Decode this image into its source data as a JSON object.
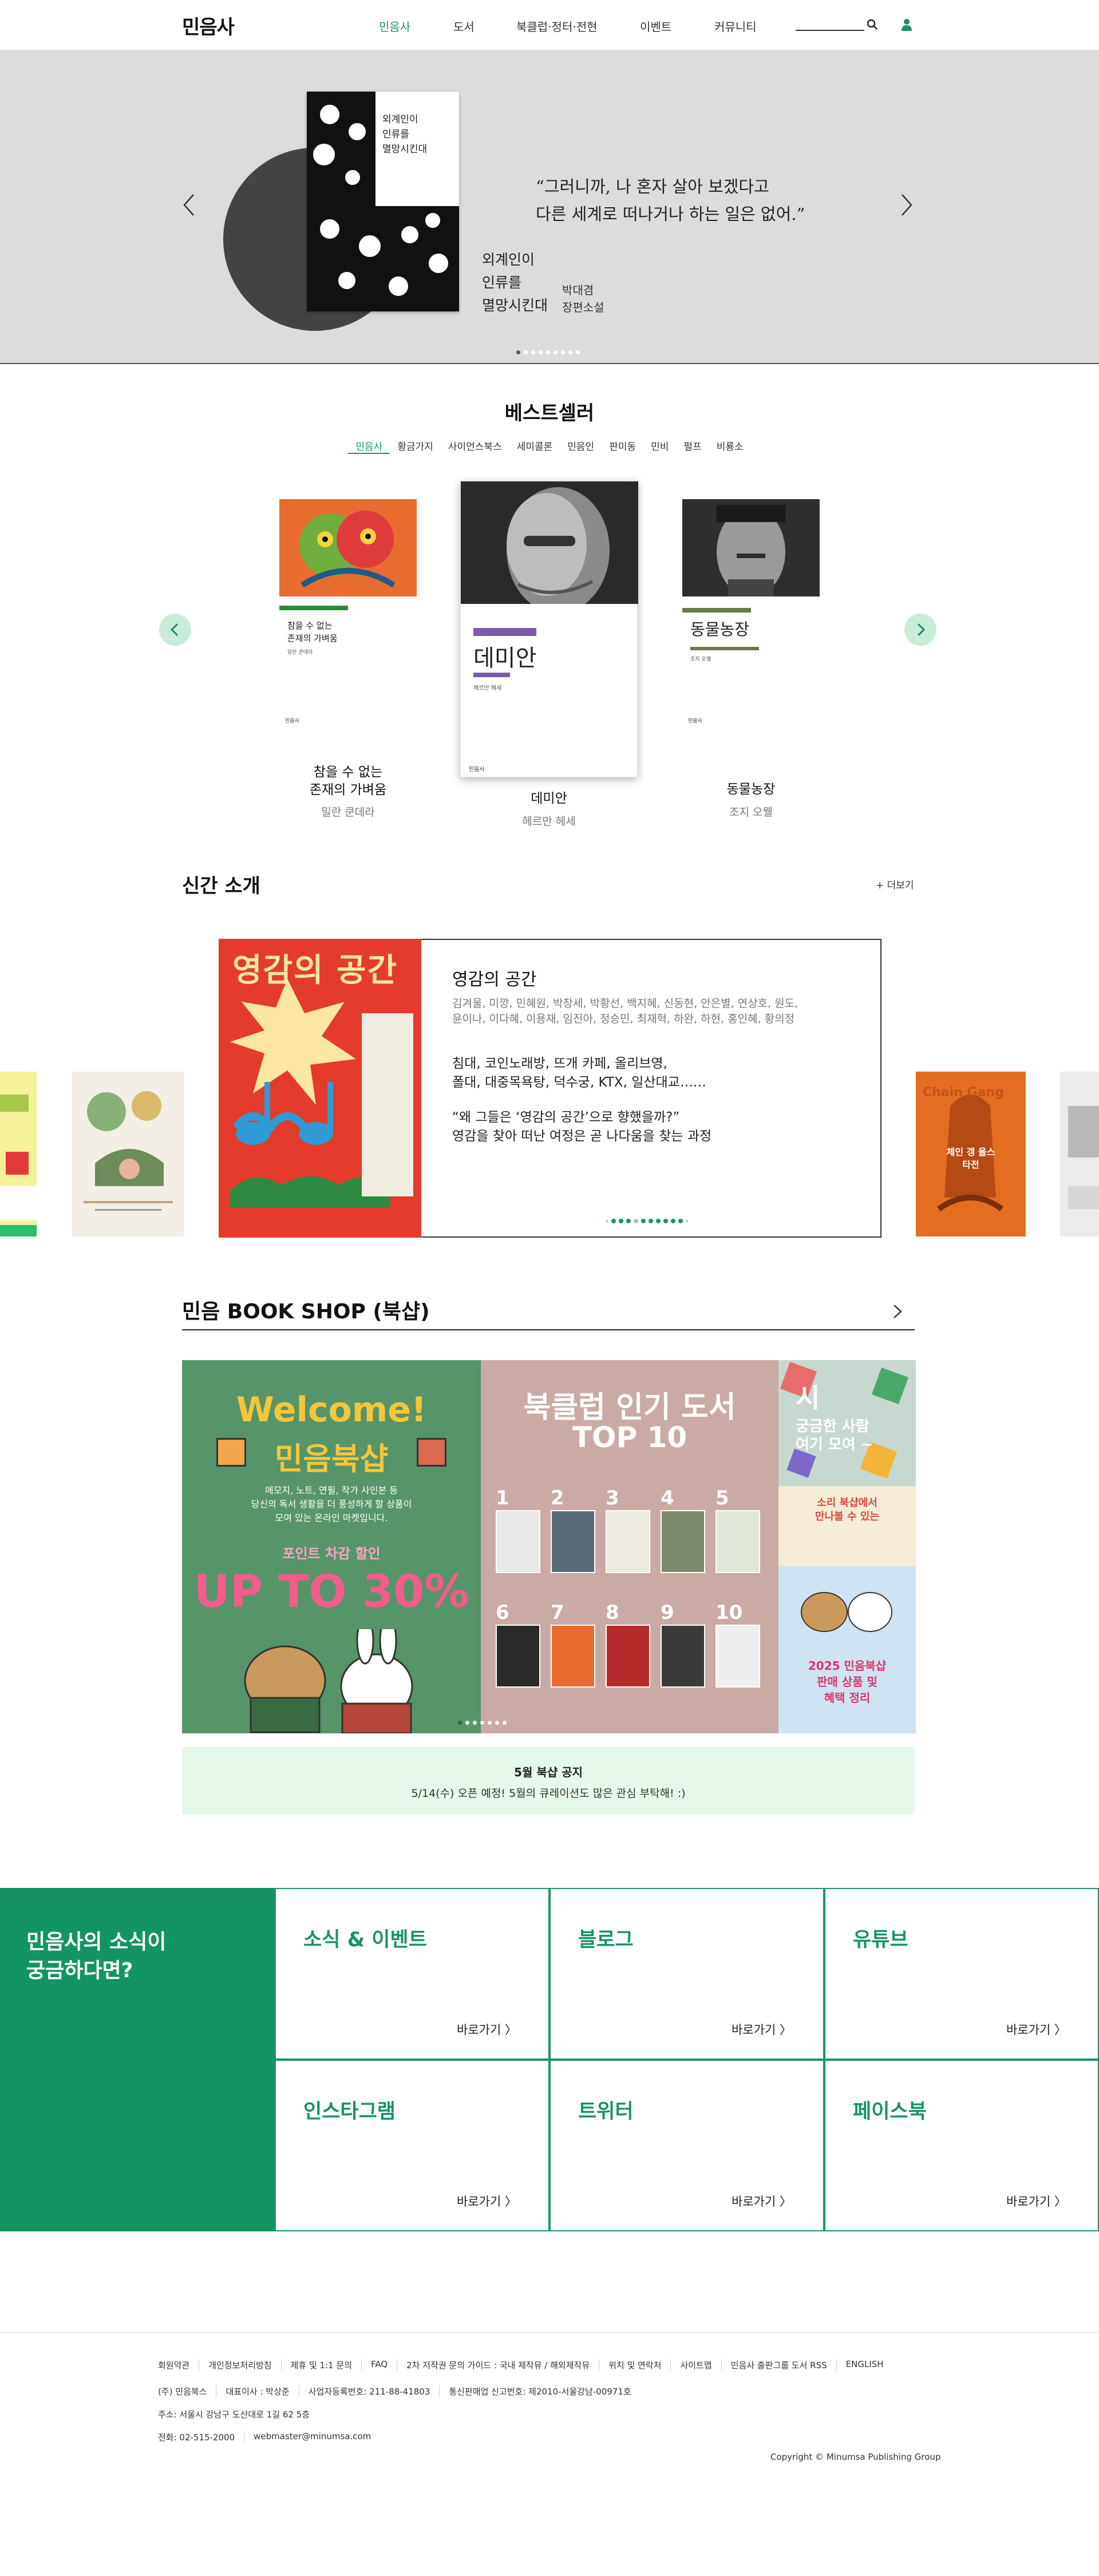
{
  "header": {
    "logo": "민음사",
    "nav": [
      "민음사",
      "도서",
      "북클럽·정터·전현",
      "이벤트",
      "커뮤니티"
    ],
    "active_nav": "민음사"
  },
  "hero": {
    "quote": "“그러니까, 나 혼자 살아 보겠다고\n다른 세계로 떠나거나 하는 일은 없어.”",
    "book_title": "외계인이\n인류를\n멸망시킨대",
    "author": "박대겸\n장편소설",
    "cover_title": "외계인이\n인류를\n멸망시킨대",
    "slide_count": 9,
    "active_slide": 1
  },
  "bestseller": {
    "title": "베스트셀러",
    "tabs": [
      "민음사",
      "황금가지",
      "사이언스북스",
      "세미콜론",
      "민음인",
      "판미동",
      "민비",
      "펄프",
      "비룡소"
    ],
    "active_tab": "민음사",
    "books": [
      {
        "title": "참을 수 없는\n존재의 가벼움",
        "author": "밀란 쿤데라",
        "cover_title": "참을 수 없는\n존재의 가벼움",
        "cover_author": "밀란 쿤데라"
      },
      {
        "title": "데미안",
        "author": "헤르만 헤세",
        "cover_title": "데미안",
        "cover_author": "헤르만 헤세"
      },
      {
        "title": "동물농장",
        "author": "조지 오웰",
        "cover_title": "동물농장",
        "cover_author": "조지 오웰"
      }
    ],
    "publisher_mark": "민음사"
  },
  "new_books": {
    "title": "신간 소개",
    "more": "+ 더보기",
    "featured": {
      "title": "영감의 공간",
      "authors": "김겨울, 미깡, 민혜원, 박창세, 박황선, 백지혜, 신동현, 안은별, 연상호, 원도, 윤이나, 이다혜, 이용재, 임진아, 정승민, 최재혁, 하완, 하현, 홍인혜, 황의정",
      "desc1": "침대, 코인노래방, 뜨개 카페, 올리브영,\n폴대, 대중목욕탕, 덕수궁, KTX, 일산대교……",
      "desc2": "“왜 그들은 ‘영감의 공간’으로 향했을까?”\n영감을 찾아 떠난 여정은 곧 나다움을 찾는 과정",
      "cover_title": "영감의 공간"
    },
    "side_cover_texts": [
      "Chain Gang",
      "체인 갱 올스타전"
    ]
  },
  "shop": {
    "title": "민음 BOOK SHOP (북샵)",
    "panel1": {
      "headline": "Welcome!",
      "sub": "민음북샵",
      "body": "메모지, 노트, 연필, 작가 사인본 등\n당신의 독서 생활을 더 풍성하게 할 상품이\n모여 있는 온라인 마켓입니다.",
      "badge": "포인트 차감 할인",
      "big": "UP TO 30%"
    },
    "panel2": {
      "headline": "북클럽 인기 도서",
      "sub": "TOP 10",
      "ranks": [
        "1",
        "2",
        "3",
        "4",
        "5",
        "6",
        "7",
        "8",
        "9",
        "10"
      ]
    },
    "panel3": {
      "headline": "시",
      "sub": "궁금한 사람\n여기 모여 ~",
      "mid": "소리 북샵에서\n만나볼 수 있는",
      "bottom": "2025 민음북샵\n판매 상품 및\n혜택 정리"
    },
    "notice_title": "5월 북샵 공지",
    "notice_body": "5/14(수) 오픈 예정! 5월의 큐레이션도 많은 관심 부탁해! :)"
  },
  "sns": {
    "headline": "민음사의 소식이\n궁금하다면?",
    "go": "바로가기",
    "items": [
      "소식 & 이벤트",
      "블로그",
      "유튜브",
      "인스타그램",
      "트위터",
      "페이스북"
    ]
  },
  "footer": {
    "links": [
      "회원약관",
      "개인정보처리방침",
      "제휴 및 1:1 문의",
      "FAQ",
      "2차 저작권 문의 가이드 : 국내 제작뮤 / 해외제작뮤",
      "위치 및 연락처",
      "사이트맵",
      "민음사 출판그룹 도서 RSS",
      "ENGLISH"
    ],
    "company": [
      "(주) 민음북스",
      "대표이사 : 박상준",
      "사업자등록번호: 211-88-41803",
      "통신판매업 신고번호: 제2010-서울강남-00971호"
    ],
    "address": "주소: 서울시 강남구 도산대로 1길 62 5층",
    "contact": [
      "전화: 02-515-2000",
      "webmaster@minumsa.com"
    ],
    "copyright": "Copyright © Minumsa Publishing Group"
  },
  "colors": {
    "accent": "#159463",
    "hero_bg": "#dcdcdc",
    "notice_bg": "#e6f8ea"
  }
}
